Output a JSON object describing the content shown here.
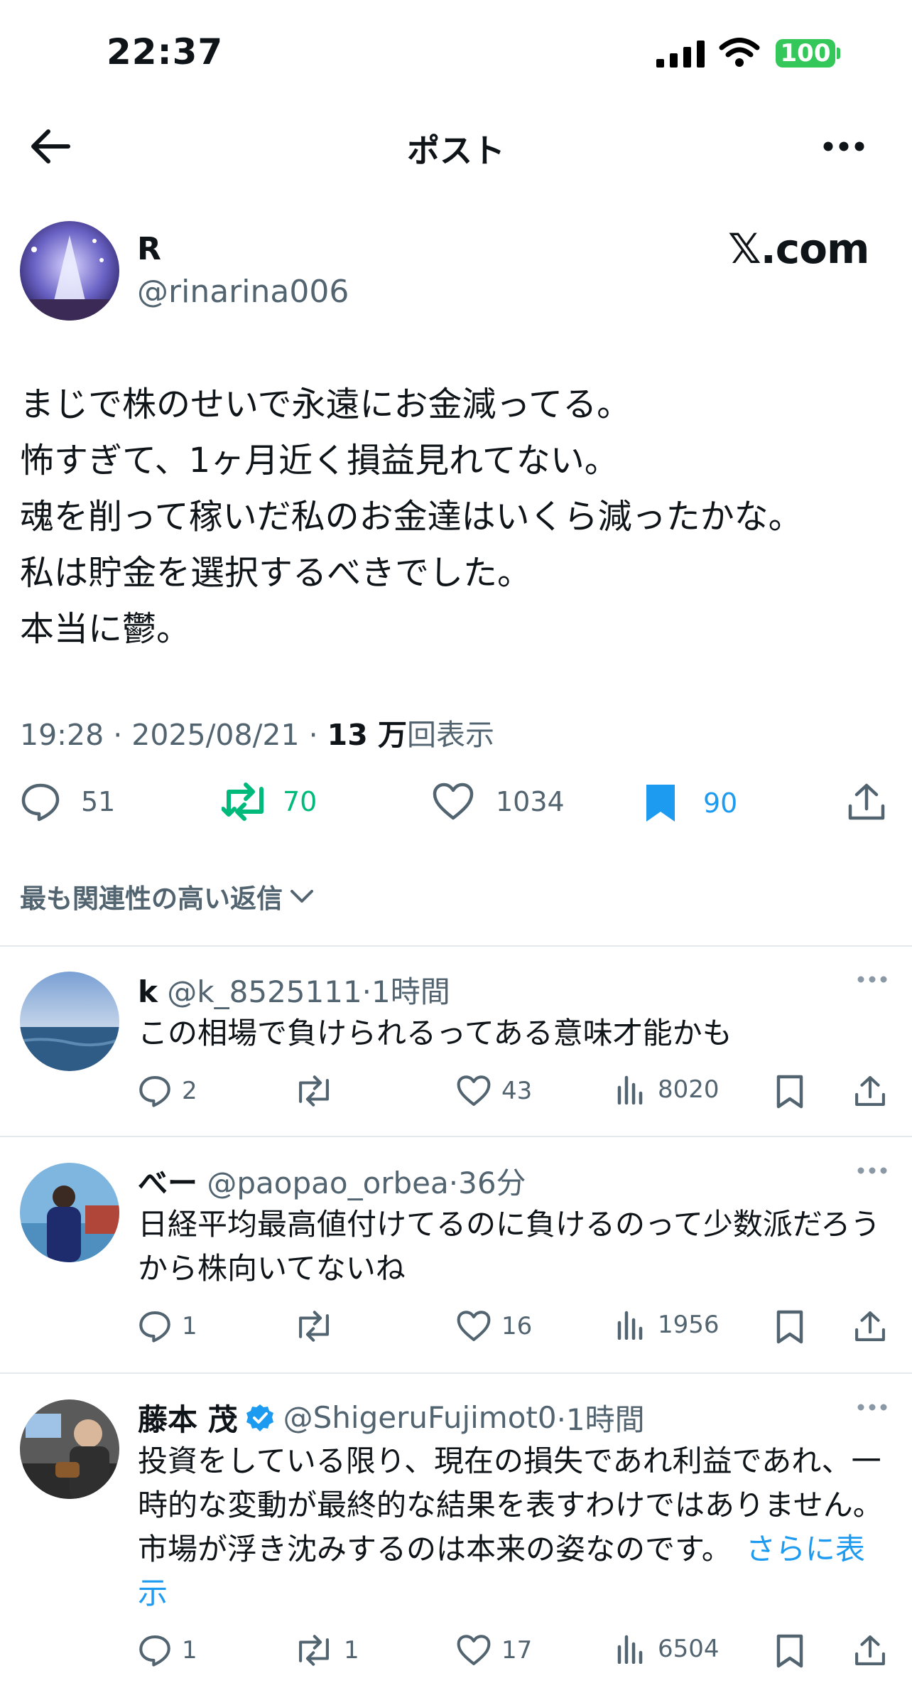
{
  "status_bar": {
    "time": "22:37",
    "battery": "100"
  },
  "header": {
    "title": "ポスト"
  },
  "post": {
    "author_name": "R",
    "handle": "@rinarina006",
    "watermark": "𝕏.com",
    "lines": [
      "まじで株のせいで永遠にお金減ってる。",
      "怖すぎて、1ヶ月近く損益見れてない。",
      "魂を削って稼いだ私のお金達はいくら減ったかな。",
      "私は貯金を選択するべきでした。",
      "本当に鬱。"
    ],
    "time": "19:28 · 2025/08/21 · ",
    "views_count": "13 万",
    "views_label": "回表示",
    "replies": "51",
    "reposts": "70",
    "likes": "1034",
    "bookmarks": "90",
    "colors": {
      "repost": "#00ba7c",
      "bookmark": "#1d9bf0"
    }
  },
  "sort_label": "最も関連性の高い返信",
  "replies": [
    {
      "name": "k",
      "handle": "@k_8525111",
      "time": "·1時間",
      "text": "この相場で負けられるってある意味才能かも",
      "replies": "2",
      "reposts": "",
      "likes": "43",
      "views": "8020"
    },
    {
      "name": "べー",
      "handle": "@paopao_orbea",
      "time": "·36分",
      "text": "日経平均最高値付けてるのに負けるのって少数派だろうから株向いてないね",
      "replies": "1",
      "reposts": "",
      "likes": "16",
      "views": "1956"
    },
    {
      "name": "藤本 茂",
      "handle": "@ShigeruFujimot0",
      "time": "·1時間",
      "text": "投資をしている限り、現在の損失であれ利益であれ、一時的な変動が最終的な結果を表すわけではありません。市場が浮き沈みするのは本来の姿なのです。",
      "more": "さらに表示",
      "replies": "1",
      "reposts": "1",
      "likes": "17",
      "views": "6504"
    }
  ]
}
